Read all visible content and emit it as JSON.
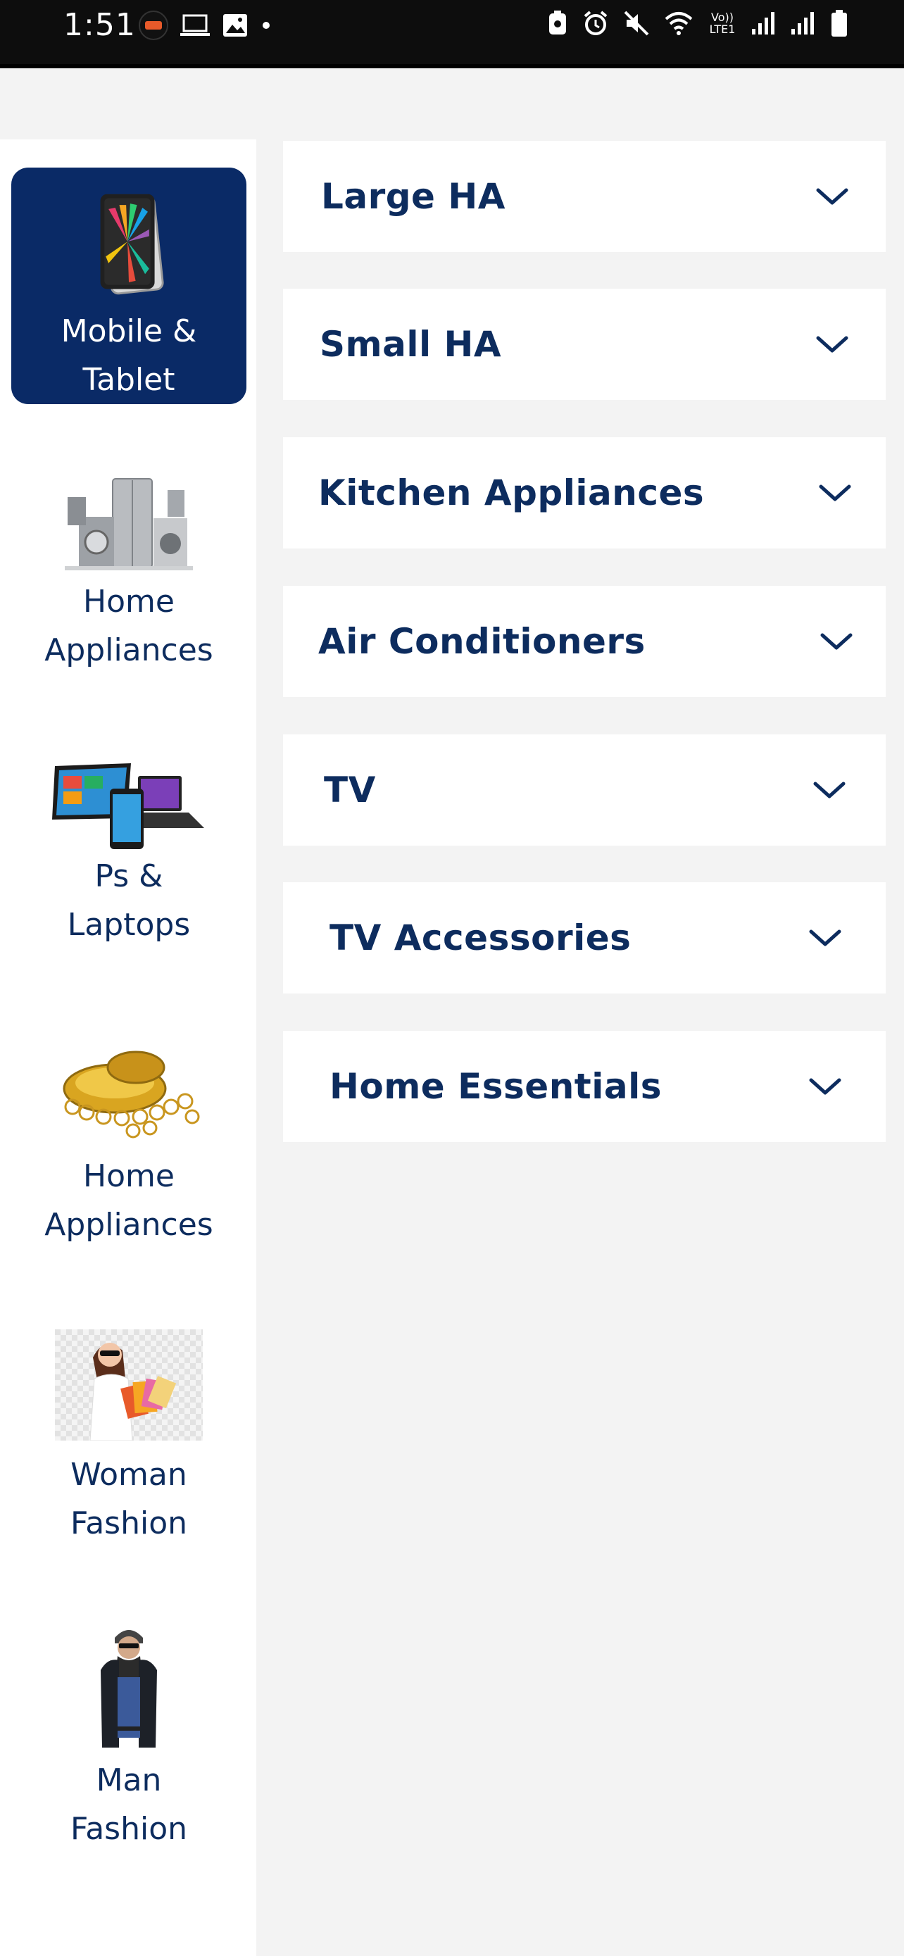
{
  "status_bar": {
    "time": "1:51",
    "network_label": "Vo)) LTE1"
  },
  "sidebar": {
    "active_color": "#0a2a66",
    "items": [
      {
        "label": "Mobile &\nTablet",
        "icon": "tablet-image",
        "active": true
      },
      {
        "label": "Home\nAppliances",
        "icon": "home-appliances-image",
        "active": false
      },
      {
        "label": "Ps &\nLaptops",
        "icon": "laptops-image",
        "active": false
      },
      {
        "label": "Home\nAppliances",
        "icon": "gold-jewelry-image",
        "active": false
      },
      {
        "label": "Woman\nFashion",
        "icon": "woman-shopping-image",
        "active": false
      },
      {
        "label": "Man\nFashion",
        "icon": "man-fashion-image",
        "active": false
      }
    ]
  },
  "categories": [
    {
      "title": "Large HA",
      "icon": "chevron-down-icon"
    },
    {
      "title": "Small HA",
      "icon": "chevron-down-icon"
    },
    {
      "title": "Kitchen Appliances",
      "icon": "chevron-down-icon"
    },
    {
      "title": "Air Conditioners",
      "icon": "chevron-down-icon"
    },
    {
      "title": "TV",
      "icon": "chevron-down-icon"
    },
    {
      "title": "TV Accessories",
      "icon": "chevron-down-icon"
    },
    {
      "title": "Home Essentials",
      "icon": "chevron-down-icon"
    }
  ],
  "colors": {
    "text_primary": "#0d2c5e",
    "background": "#f3f3f3",
    "card": "#ffffff"
  }
}
